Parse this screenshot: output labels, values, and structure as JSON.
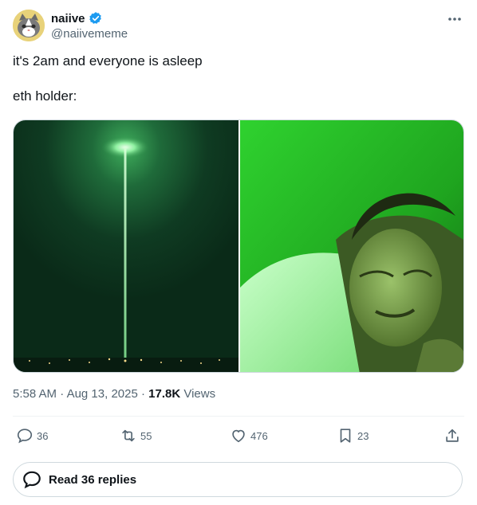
{
  "author": {
    "name": "naiive",
    "handle": "@naiivememe",
    "avatar_icon": "cat-face-icon",
    "verified_color": "#1d9bf0"
  },
  "tweet": {
    "text_lines": [
      "it's 2am and everyone is asleep",
      "eth holder:"
    ]
  },
  "media": {
    "left_image": "night-sky-green-laser-beam",
    "right_image": "man-in-bed-green-light"
  },
  "meta": {
    "time": "5:58 AM",
    "separator": " · ",
    "date": "Aug 13, 2025",
    "views_count": "17.8K",
    "views_label": " Views"
  },
  "actions": {
    "replies": "36",
    "reposts": "55",
    "likes": "476",
    "bookmarks": "23"
  },
  "replies_button": {
    "label": "Read 36 replies"
  }
}
